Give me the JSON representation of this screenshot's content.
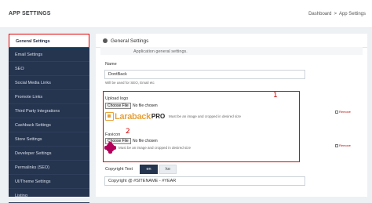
{
  "header": {
    "title": "APP SETTINGS",
    "breadcrumb": [
      "Dashboard",
      "App Settings"
    ],
    "breadcrumb_sep": ">"
  },
  "sidebar": {
    "items": [
      {
        "label": "General Settings",
        "active": true
      },
      {
        "label": "Email Settings"
      },
      {
        "label": "SEO"
      },
      {
        "label": "Social Media Links"
      },
      {
        "label": "Promote Links"
      },
      {
        "label": "Third Party Integrations"
      },
      {
        "label": "Cashback Settings"
      },
      {
        "label": "Store Settings"
      },
      {
        "label": "Developer Settings"
      },
      {
        "label": "Permalinks (SEO)"
      },
      {
        "label": "UI/Theme Settings"
      },
      {
        "label": "Listing"
      }
    ]
  },
  "main": {
    "heading": "General Settings",
    "subheading": "Application general settings.",
    "name": {
      "label": "Name",
      "value": "DontBack",
      "hint": "Will be used for SEO, Email etc"
    },
    "upload_logo": {
      "label": "Upload logo",
      "button": "Choose File",
      "status": "No file chosen",
      "hint": "Must be an image and cropped in desired size",
      "preview_text": "Laraback",
      "preview_suffix": "PRO",
      "remove": "Remove",
      "annotation": "1"
    },
    "favicon": {
      "label": "Favicon",
      "button": "Choose File",
      "status": "No file chosen",
      "hint": "Must be an image and cropped in desired size",
      "remove": "Remove",
      "annotation": "2"
    },
    "copyright": {
      "label": "Copyright Text",
      "langs": [
        "en",
        "ko"
      ],
      "active_lang": "en",
      "value": "Copyright @ #SITENAME - #YEAR"
    }
  },
  "colors": {
    "sidebar_bg": "#25344f",
    "annotation_red": "#e00000",
    "logo_orange": "#e8a23a",
    "favicon_magenta": "#b3005a"
  }
}
